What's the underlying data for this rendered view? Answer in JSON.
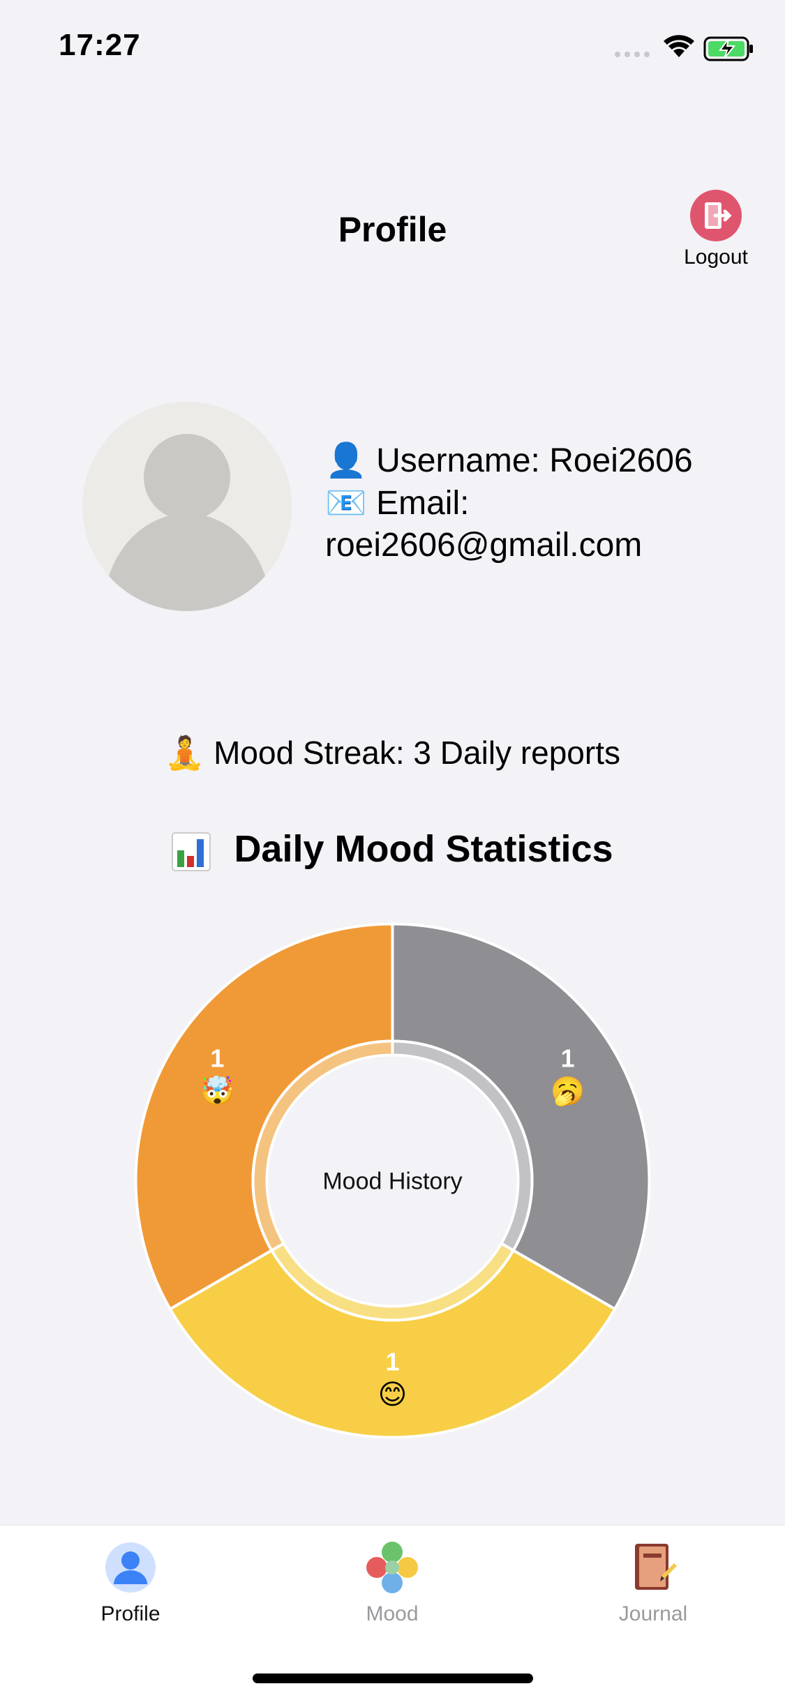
{
  "status_bar": {
    "time": "17:27"
  },
  "header": {
    "title": "Profile",
    "logout_label": "Logout"
  },
  "profile": {
    "username_label": "Username: Roei2606",
    "email_label": "Email:",
    "email_value": "roei2606@gmail.com"
  },
  "streak": {
    "text": "Mood Streak: 3 Daily reports"
  },
  "stats": {
    "title": "Daily Mood Statistics"
  },
  "chart_data": {
    "type": "pie",
    "center_label": "Mood History",
    "slices": [
      {
        "label": "🥱",
        "value": 1,
        "color": "#8e8e93",
        "inner_color": "#c2c2c4"
      },
      {
        "label": "😊",
        "value": 1,
        "color": "#f7ce46",
        "inner_color": "#f9df83"
      },
      {
        "label": "🤯",
        "value": 1,
        "color": "#f09a37",
        "inner_color": "#f5c380"
      }
    ]
  },
  "tabbar": {
    "tabs": [
      {
        "label": "Profile",
        "icon": "profile-icon",
        "active": true
      },
      {
        "label": "Mood",
        "icon": "mood-icon",
        "active": false
      },
      {
        "label": "Journal",
        "icon": "journal-icon",
        "active": false
      }
    ]
  },
  "colors": {
    "accent": "#007aff",
    "logout": "#e0556e",
    "background": "#f2f2f7"
  }
}
